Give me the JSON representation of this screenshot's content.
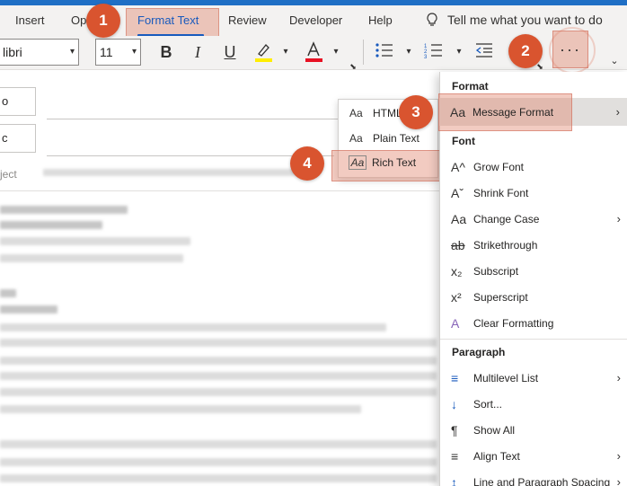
{
  "ribbon": {
    "tabs": {
      "insert": "Insert",
      "options": "Op",
      "format_text": "Format Text",
      "review": "Review",
      "developer": "Developer",
      "help": "Help"
    },
    "tell_me": "Tell me what you want to do"
  },
  "toolbar": {
    "font_name": "libri",
    "font_size": "11",
    "bold": "B",
    "italic": "I",
    "underline": "U",
    "more": "···"
  },
  "badges": {
    "one": "1",
    "two": "2",
    "three": "3",
    "four": "4"
  },
  "compose": {
    "to_label": "o",
    "cc_label": "c",
    "subject_label": "ject"
  },
  "submenu": {
    "items": [
      {
        "icon": "Aa",
        "label": "HTML"
      },
      {
        "icon": "Aa",
        "label": "Plain Text"
      },
      {
        "icon": "Aa",
        "label": "Rich Text"
      }
    ]
  },
  "menu": {
    "format_header": "Format",
    "message_format": {
      "icon": "Aa",
      "label": "Message Format"
    },
    "font_header": "Font",
    "font_items": [
      {
        "icon": "A^",
        "label": "Grow Font"
      },
      {
        "icon": "Aˇ",
        "label": "Shrink Font"
      },
      {
        "icon": "Aa",
        "label": "Change Case"
      },
      {
        "icon": "ab",
        "label": "Strikethrough"
      },
      {
        "icon": "x₂",
        "label": "Subscript"
      },
      {
        "icon": "x²",
        "label": "Superscript"
      },
      {
        "icon": "A",
        "label": "Clear Formatting"
      }
    ],
    "paragraph_header": "Paragraph",
    "paragraph_items": [
      {
        "icon": "≡",
        "label": "Multilevel List"
      },
      {
        "icon": "↓",
        "label": "Sort..."
      },
      {
        "icon": "¶",
        "label": "Show All"
      },
      {
        "icon": "≡",
        "label": "Align Text"
      },
      {
        "icon": "↕",
        "label": "Line and Paragraph Spacing"
      }
    ]
  },
  "colors": {
    "accent": "#185abd",
    "badge": "#d9542f",
    "highlight": "#e28c76",
    "font_color_bar": "#e81123",
    "highlight_color_bar": "#ffee00"
  }
}
